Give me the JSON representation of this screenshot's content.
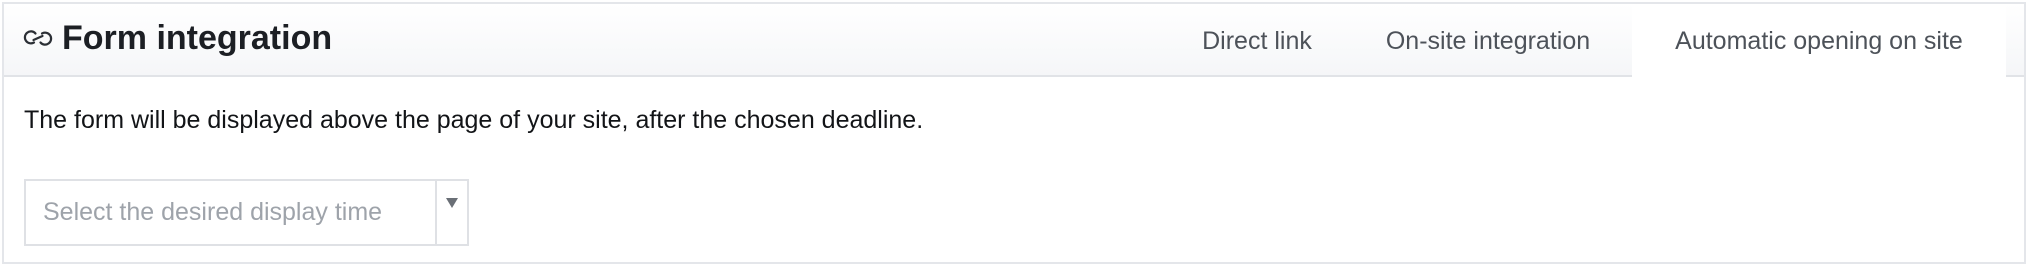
{
  "header": {
    "icon": "link-icon",
    "title": "Form integration"
  },
  "tabs": [
    {
      "label": "Direct link",
      "active": false
    },
    {
      "label": "On-site integration",
      "active": false
    },
    {
      "label": "Automatic opening on site",
      "active": true
    }
  ],
  "content": {
    "description": "The form will be displayed above the page of your site, after the chosen deadline.",
    "select": {
      "placeholder": "Select the desired display time",
      "icon": "caret-down-icon"
    }
  },
  "colors": {
    "title": "#1c1f24",
    "tab_text": "#4d5259",
    "placeholder": "#9ea3aa",
    "border": "#e1e3e7"
  }
}
